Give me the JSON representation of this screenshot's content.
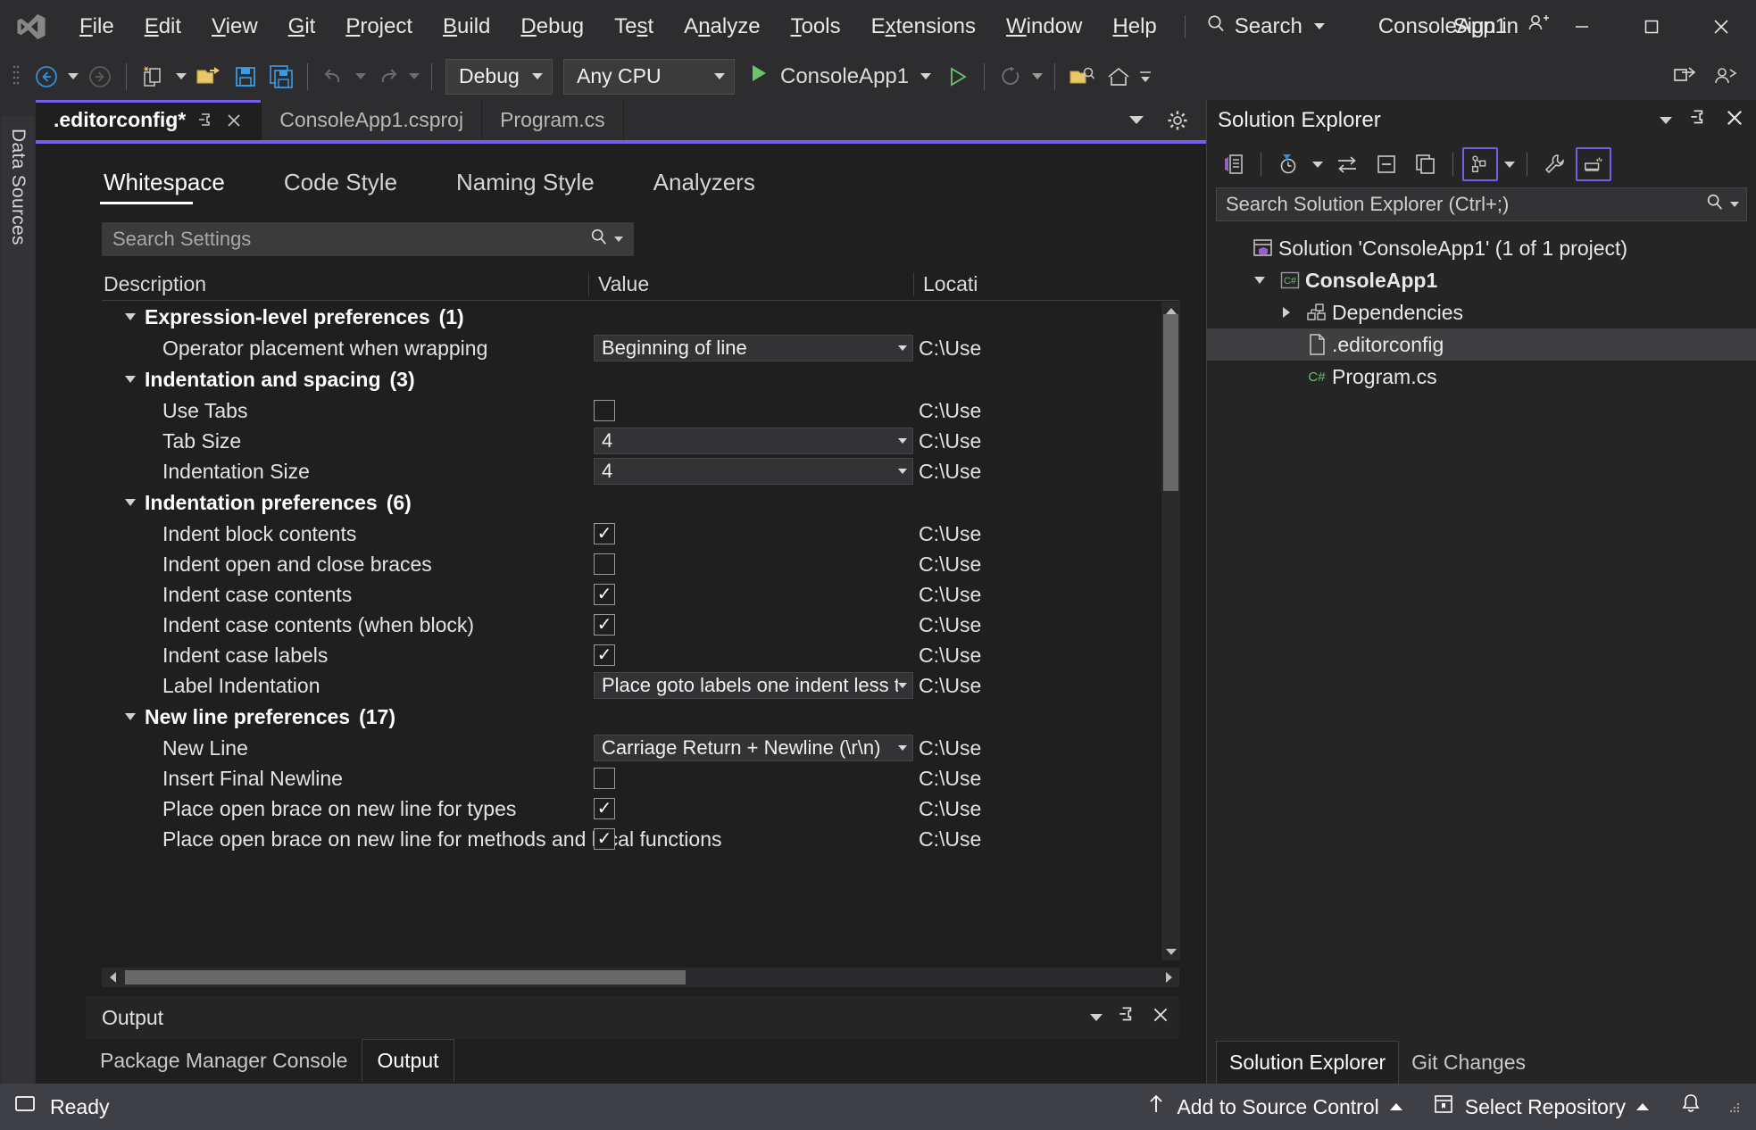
{
  "window": {
    "app_title": "ConsoleApp1",
    "sign_in_label": "Sign in",
    "minimize_icon": "minimize-icon",
    "maximize_icon": "maximize-icon",
    "close_icon": "close-icon",
    "logo_icon": "visual-studio-logo-icon"
  },
  "menu": {
    "items": [
      {
        "label": "File",
        "accel": "F"
      },
      {
        "label": "Edit",
        "accel": "E"
      },
      {
        "label": "View",
        "accel": "V"
      },
      {
        "label": "Git",
        "accel": "G"
      },
      {
        "label": "Project",
        "accel": "P"
      },
      {
        "label": "Build",
        "accel": "B"
      },
      {
        "label": "Debug",
        "accel": "D"
      },
      {
        "label": "Test",
        "accel": "s"
      },
      {
        "label": "Analyze",
        "accel": "n"
      },
      {
        "label": "Tools",
        "accel": "T"
      },
      {
        "label": "Extensions",
        "accel": "x"
      },
      {
        "label": "Window",
        "accel": "W"
      },
      {
        "label": "Help",
        "accel": "H"
      }
    ],
    "search_label": "Search",
    "search_icon": "search-icon"
  },
  "toolbar": {
    "back_icon": "navigate-back-icon",
    "forward_icon": "navigate-forward-icon",
    "new_project_icon": "new-project-icon",
    "open_file_icon": "open-file-icon",
    "save_icon": "save-icon",
    "save_all_icon": "save-all-icon",
    "undo_icon": "undo-icon",
    "redo_icon": "redo-icon",
    "configuration": "Debug",
    "platform": "Any CPU",
    "run_label": "ConsoleApp1",
    "run_icon": "run-start-icon",
    "run_without_debug_icon": "run-without-debugging-icon",
    "hot_reload_icon": "hot-reload-icon",
    "select_startup_icon": "select-startup-item-icon",
    "live_share_icon": "live-share-icon",
    "feedback_icon": "send-feedback-icon",
    "overflow_icon": "toolbar-overflow-icon",
    "home_icon": "home-icon"
  },
  "left_rail": {
    "data_sources_label": "Data Sources"
  },
  "document_tabs": {
    "tabs": [
      {
        "label": ".editorconfig*",
        "active": true
      },
      {
        "label": "ConsoleApp1.csproj",
        "active": false
      },
      {
        "label": "Program.cs",
        "active": false
      }
    ],
    "pin_icon": "pin-tab-icon",
    "close_icon": "close-tab-icon",
    "tablist_icon": "tab-list-dropdown-icon",
    "settings_icon": "gear-icon"
  },
  "editorconfig": {
    "sub_tabs": [
      {
        "label": "Whitespace",
        "active": true
      },
      {
        "label": "Code Style",
        "active": false
      },
      {
        "label": "Naming Style",
        "active": false
      },
      {
        "label": "Analyzers",
        "active": false
      }
    ],
    "search_placeholder": "Search Settings",
    "search_icon": "search-icon",
    "search_dropdown_icon": "chevron-down-icon",
    "columns": [
      "Description",
      "Value",
      "Locati"
    ],
    "location_value": "C:\\Use",
    "rows": [
      {
        "kind": "group",
        "label": "Expression-level preferences",
        "count": "(1)"
      },
      {
        "kind": "combo",
        "label": "Operator placement when wrapping",
        "value": "Beginning of line",
        "location": "C:\\Use"
      },
      {
        "kind": "group",
        "label": "Indentation and spacing",
        "count": "(3)"
      },
      {
        "kind": "check",
        "label": "Use Tabs",
        "checked": false,
        "location": "C:\\Use"
      },
      {
        "kind": "combo",
        "label": "Tab Size",
        "value": "4",
        "location": "C:\\Use"
      },
      {
        "kind": "combo",
        "label": "Indentation Size",
        "value": "4",
        "location": "C:\\Use"
      },
      {
        "kind": "group",
        "label": "Indentation preferences",
        "count": "(6)"
      },
      {
        "kind": "check",
        "label": "Indent block contents",
        "checked": true,
        "location": "C:\\Use"
      },
      {
        "kind": "check",
        "label": "Indent open and close braces",
        "checked": false,
        "location": "C:\\Use"
      },
      {
        "kind": "check",
        "label": "Indent case contents",
        "checked": true,
        "location": "C:\\Use"
      },
      {
        "kind": "check",
        "label": "Indent case contents (when block)",
        "checked": true,
        "location": "C:\\Use"
      },
      {
        "kind": "check",
        "label": "Indent case labels",
        "checked": true,
        "location": "C:\\Use"
      },
      {
        "kind": "combo",
        "label": "Label Indentation",
        "value": "Place goto labels one indent less than curren",
        "location": "C:\\Use"
      },
      {
        "kind": "group",
        "label": "New line preferences",
        "count": "(17)"
      },
      {
        "kind": "combo",
        "label": "New Line",
        "value": "Carriage Return + Newline (\\r\\n)",
        "location": "C:\\Use"
      },
      {
        "kind": "check",
        "label": "Insert Final Newline",
        "checked": false,
        "location": "C:\\Use"
      },
      {
        "kind": "check",
        "label": "Place open brace on new line for types",
        "checked": true,
        "location": "C:\\Use"
      },
      {
        "kind": "check",
        "label": "Place open brace on new line for methods and local functions",
        "checked": true,
        "location": "C:\\Use"
      }
    ]
  },
  "output_pane": {
    "title": "Output",
    "dropdown_icon": "chevron-down-icon",
    "pin_icon": "pin-icon",
    "close_icon": "close-icon",
    "tabs": [
      {
        "label": "Package Manager Console",
        "active": false
      },
      {
        "label": "Output",
        "active": true
      }
    ]
  },
  "solution_explorer": {
    "title": "Solution Explorer",
    "dropdown_icon": "chevron-down-icon",
    "pin_icon": "pin-icon",
    "close_icon": "close-icon",
    "toolbar_icons": [
      "solution-explorer-home-icon",
      "pending-changes-filter-icon",
      "sync-with-active-document-icon",
      "collapse-all-icon",
      "show-all-files-icon",
      "view-class-diagram-icon",
      "properties-icon",
      "preview-selected-items-icon"
    ],
    "search_placeholder": "Search Solution Explorer (Ctrl+;)",
    "search_icon": "search-icon",
    "search_dropdown_icon": "chevron-down-icon",
    "tree": [
      {
        "label": "Solution 'ConsoleApp1' (1 of 1 project)",
        "depth": 0,
        "icon": "solution-icon",
        "expander": "none",
        "bold": false,
        "selected": false
      },
      {
        "label": "ConsoleApp1",
        "depth": 1,
        "icon": "csharp-project-icon",
        "expander": "expanded",
        "bold": true,
        "selected": false
      },
      {
        "label": "Dependencies",
        "depth": 2,
        "icon": "dependencies-icon",
        "expander": "collapsed",
        "bold": false,
        "selected": false
      },
      {
        "label": ".editorconfig",
        "depth": 2,
        "icon": "file-icon",
        "expander": "none",
        "bold": false,
        "selected": true
      },
      {
        "label": "Program.cs",
        "depth": 2,
        "icon": "csharp-file-icon",
        "expander": "none",
        "bold": false,
        "selected": false
      }
    ],
    "bottom_tabs": [
      {
        "label": "Solution Explorer",
        "active": true
      },
      {
        "label": "Git Changes",
        "active": false
      }
    ]
  },
  "status_bar": {
    "ready_label": "Ready",
    "ready_icon": "status-ready-icon",
    "add_to_source_control": "Add to Source Control",
    "add_to_source_control_icon": "upload-arrow-icon",
    "select_repository": "Select Repository",
    "select_repository_icon": "repository-icon",
    "notifications_icon": "bell-icon",
    "resize_grip_icon": "resize-grip-icon"
  },
  "colors": {
    "accent_purple": "#7160e8",
    "titlebar_bg": "#2d2d30",
    "editor_bg": "#1f1f1f",
    "panel_bg": "#252526",
    "statusbar_bg": "#3f3f46",
    "run_green": "#6ec26e",
    "close_red": "#c42b1c"
  }
}
